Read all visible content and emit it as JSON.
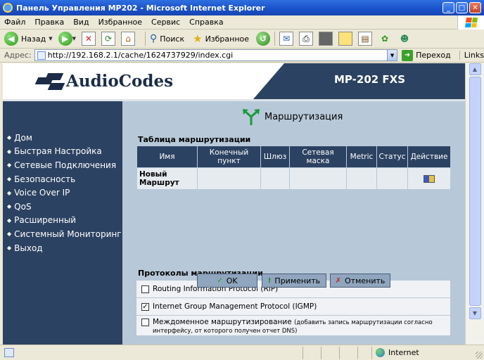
{
  "window": {
    "title": "Панель Управления МР202 - Microsoft Internet Explorer"
  },
  "menubar": [
    "Файл",
    "Правка",
    "Вид",
    "Избранное",
    "Сервис",
    "Справка"
  ],
  "toolbar": {
    "back": "Назад",
    "search": "Поиск",
    "favorites": "Избранное"
  },
  "addressbar": {
    "label": "Адрес:",
    "url": "http://192.168.2.1/cache/1624737929/index.cgi",
    "go": "Переход",
    "links": "Links"
  },
  "header": {
    "logo": "AudioCodes",
    "model": "MP-202 FXS"
  },
  "sidebar": {
    "items": [
      "Дом",
      "Быстрая Настройка",
      "Сетевые Подключения",
      "Безопасность",
      "Voice Over IP",
      "QoS",
      "Расширенный",
      "Системный Мониторинг",
      "Выход"
    ]
  },
  "page": {
    "title": "Маршрутизация"
  },
  "routing_table": {
    "title": "Таблица маршрутизации",
    "columns": [
      "Имя",
      "Конечный пункт",
      "Шлюз",
      "Сетевая маска",
      "Metric",
      "Статус",
      "Действие"
    ],
    "new_route": "Новый Маршрут"
  },
  "protocols": {
    "title": "Протоколы маршрутизации",
    "items": [
      {
        "label": "Routing Information Protocol (RIP)",
        "checked": false
      },
      {
        "label": "Internet Group Management Protocol (IGMP)",
        "checked": true
      },
      {
        "label": "Междоменное маршрутизирование",
        "note": "(добавить запись маршрутизации согласно интерфейсу, от которого получен отчет DNS)",
        "checked": false
      }
    ]
  },
  "buttons": {
    "ok": "OK",
    "apply": "Применить",
    "cancel": "Отменить"
  },
  "statusbar": {
    "zone": "Internet"
  }
}
